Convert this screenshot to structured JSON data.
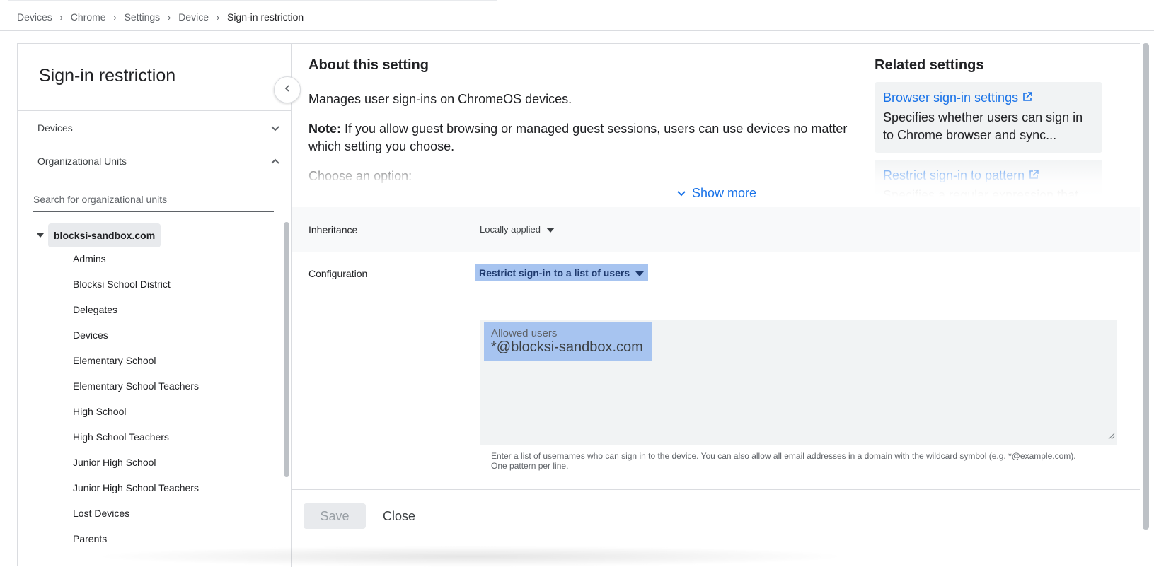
{
  "breadcrumb": [
    "Devices",
    "Chrome",
    "Settings",
    "Device",
    "Sign-in restriction"
  ],
  "left_panel": {
    "title": "Sign-in restriction",
    "accordions": {
      "devices": "Devices",
      "org_units": "Organizational Units"
    },
    "search_placeholder": "Search for organizational units",
    "root_ou": "blocksi-sandbox.com",
    "ous": [
      "Admins",
      "Blocksi School District",
      "Delegates",
      "Devices",
      "Elementary School",
      "Elementary School Teachers",
      "High School",
      "High School Teachers",
      "Junior High School",
      "Junior High School Teachers",
      "Lost Devices",
      "Parents"
    ]
  },
  "about": {
    "heading": "About this setting",
    "description": "Manages user sign-ins on ChromeOS devices.",
    "note_label": "Note:",
    "note_text": " If you allow guest browsing or managed guest sessions, users can use devices no matter which setting you choose.",
    "choose": "Choose an option:",
    "show_more": "Show more"
  },
  "related": {
    "heading": "Related settings",
    "items": [
      {
        "title": "Browser sign-in settings",
        "desc": "Specifies whether users can sign in to Chrome browser and sync..."
      },
      {
        "title": "Restrict sign-in to pattern",
        "desc": "Specifies a regular expression that"
      }
    ]
  },
  "inheritance": {
    "label": "Inheritance",
    "value": "Locally applied"
  },
  "configuration": {
    "label": "Configuration",
    "value": "Restrict sign-in to a list of users",
    "allowed_users_label": "Allowed users",
    "allowed_users_value": "*@blocksi-sandbox.com",
    "help_text": "Enter a list of usernames who can sign in to the device. You can also allow all email addresses in a domain with the wildcard symbol (e.g. *@example.com). One pattern per line."
  },
  "actions": {
    "save": "Save",
    "close": "Close"
  },
  "colors": {
    "link": "#1a73e8",
    "selection": "#a7c4f0"
  }
}
